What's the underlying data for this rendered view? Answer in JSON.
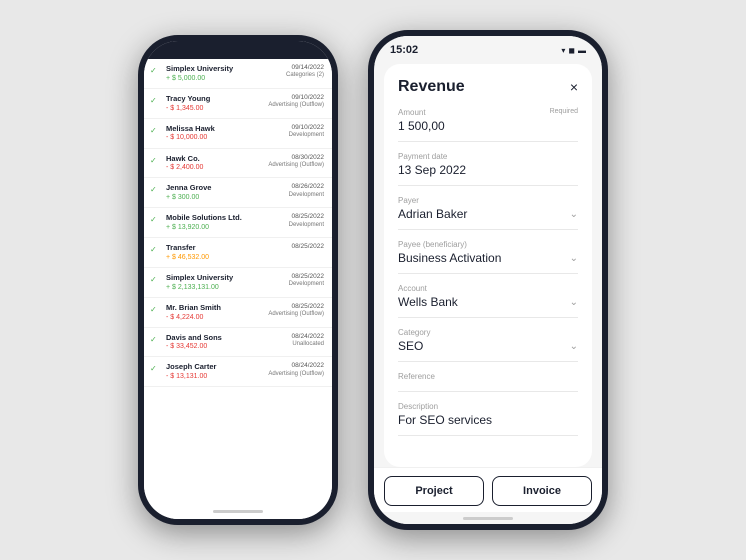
{
  "left_phone": {
    "transactions": [
      {
        "name": "Simplex University",
        "amount": "+ $ 5,000.00",
        "amount_type": "positive",
        "date": "09/14/2022",
        "category": "Categories (2)",
        "checked": true
      },
      {
        "name": "Tracy Young",
        "amount": "- $ 1,345.00",
        "amount_type": "negative",
        "date": "09/10/2022",
        "category": "Advertising (Outflow)",
        "checked": true
      },
      {
        "name": "Melissa Hawk",
        "amount": "- $ 10,000.00",
        "amount_type": "negative",
        "date": "09/10/2022",
        "category": "Development",
        "checked": true
      },
      {
        "name": "Hawk Co.",
        "amount": "- $ 2,400.00",
        "amount_type": "negative",
        "date": "08/30/2022",
        "category": "Advertising (Outflow)",
        "checked": true
      },
      {
        "name": "Jenna Grove",
        "amount": "+ $ 300.00",
        "amount_type": "positive",
        "date": "08/26/2022",
        "category": "Development",
        "checked": true
      },
      {
        "name": "Mobile Solutions Ltd.",
        "amount": "+ $ 13,920.00",
        "amount_type": "positive",
        "date": "08/25/2022",
        "category": "Development",
        "checked": true
      },
      {
        "name": "Transfer",
        "amount": "+ $ 46,532.00",
        "amount_type": "orange",
        "date": "08/25/2022",
        "category": "",
        "checked": true
      },
      {
        "name": "Simplex University",
        "amount": "+ $ 2,133,131.00",
        "amount_type": "positive",
        "date": "08/25/2022",
        "category": "Development",
        "checked": true
      },
      {
        "name": "Mr. Brian Smith",
        "amount": "- $ 4,224.00",
        "amount_type": "negative",
        "date": "08/25/2022",
        "category": "Advertising (Outflow)",
        "checked": true
      },
      {
        "name": "Davis and Sons",
        "amount": "- $ 33,452.00",
        "amount_type": "negative",
        "date": "08/24/2022",
        "category": "Unallocated",
        "checked": true
      },
      {
        "name": "Joseph Carter",
        "amount": "- $ 13,131.00",
        "amount_type": "negative",
        "date": "08/24/2022",
        "category": "Advertising (Outflow)",
        "checked": true
      }
    ]
  },
  "right_phone": {
    "status_time": "15:02",
    "modal": {
      "title": "Revenue",
      "close_label": "×",
      "fields": [
        {
          "label": "Amount",
          "value": "1 500,00",
          "has_required": true,
          "required_text": "Required",
          "has_chevron": false
        },
        {
          "label": "Payment date",
          "value": "13 Sep 2022",
          "has_required": false,
          "has_chevron": false
        },
        {
          "label": "Payer",
          "value": "Adrian Baker",
          "has_required": false,
          "has_chevron": true
        },
        {
          "label": "Payee (beneficiary)",
          "value": "Business Activation",
          "has_required": false,
          "has_chevron": true
        },
        {
          "label": "Account",
          "value": "Wells Bank",
          "has_required": false,
          "has_chevron": true
        },
        {
          "label": "Category",
          "value": "SEO",
          "has_required": false,
          "has_chevron": true
        },
        {
          "label": "Reference",
          "value": "",
          "has_required": false,
          "has_chevron": false
        },
        {
          "label": "Description",
          "value": "For SEO services",
          "has_required": false,
          "has_chevron": false
        }
      ],
      "footer_buttons": [
        "Project",
        "Invoice"
      ]
    }
  }
}
